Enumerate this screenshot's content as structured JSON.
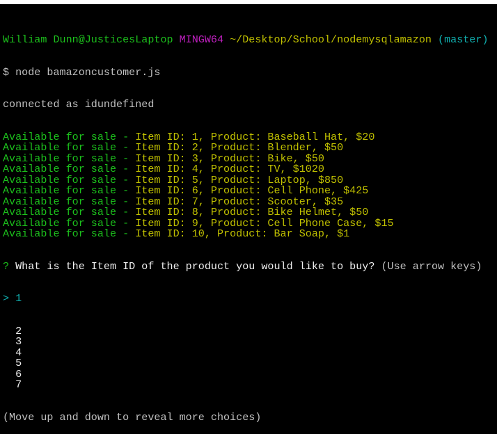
{
  "window": {
    "title_bar": ""
  },
  "prompt": {
    "user_host": "William Dunn@JusticesLaptop",
    "system": "MINGW64",
    "path": "~/Desktop/School/nodemysqlamazon",
    "branch": "(master)"
  },
  "command": {
    "symbol": "$",
    "text": "node bamazoncustomer.js"
  },
  "connected_msg": "connected as idundefined",
  "items": [
    {
      "prefix": "Available for sale - ",
      "text": "Item ID: 1, Product: Baseball Hat, $20"
    },
    {
      "prefix": "Available for sale - ",
      "text": "Item ID: 2, Product: Blender, $50"
    },
    {
      "prefix": "Available for sale - ",
      "text": "Item ID: 3, Product: Bike, $50"
    },
    {
      "prefix": "Available for sale - ",
      "text": "Item ID: 4, Product: TV, $1020"
    },
    {
      "prefix": "Available for sale - ",
      "text": "Item ID: 5, Product: Laptop, $850"
    },
    {
      "prefix": "Available for sale - ",
      "text": "Item ID: 6, Product: Cell Phone, $425"
    },
    {
      "prefix": "Available for sale - ",
      "text": "Item ID: 7, Product: Scooter, $35"
    },
    {
      "prefix": "Available for sale - ",
      "text": "Item ID: 8, Product: Bike Helmet, $50"
    },
    {
      "prefix": "Available for sale - ",
      "text": "Item ID: 9, Product: Cell Phone Case, $15"
    },
    {
      "prefix": "Available for sale - ",
      "text": "Item ID: 10, Product: Bar Soap, $1"
    }
  ],
  "question": {
    "mark": "?",
    "text": "What is the Item ID of the product you would like to buy?",
    "hint": "(Use arrow keys)"
  },
  "choices": {
    "pointer": ">",
    "selected": "1",
    "options": [
      "2",
      "3",
      "4",
      "5",
      "6",
      "7"
    ]
  },
  "footer_hint": "(Move up and down to reveal more choices)",
  "colors": {
    "green": "#1cc01c",
    "magenta": "#c020c0",
    "yellow": "#c0c000",
    "cyan": "#10b0b0"
  }
}
